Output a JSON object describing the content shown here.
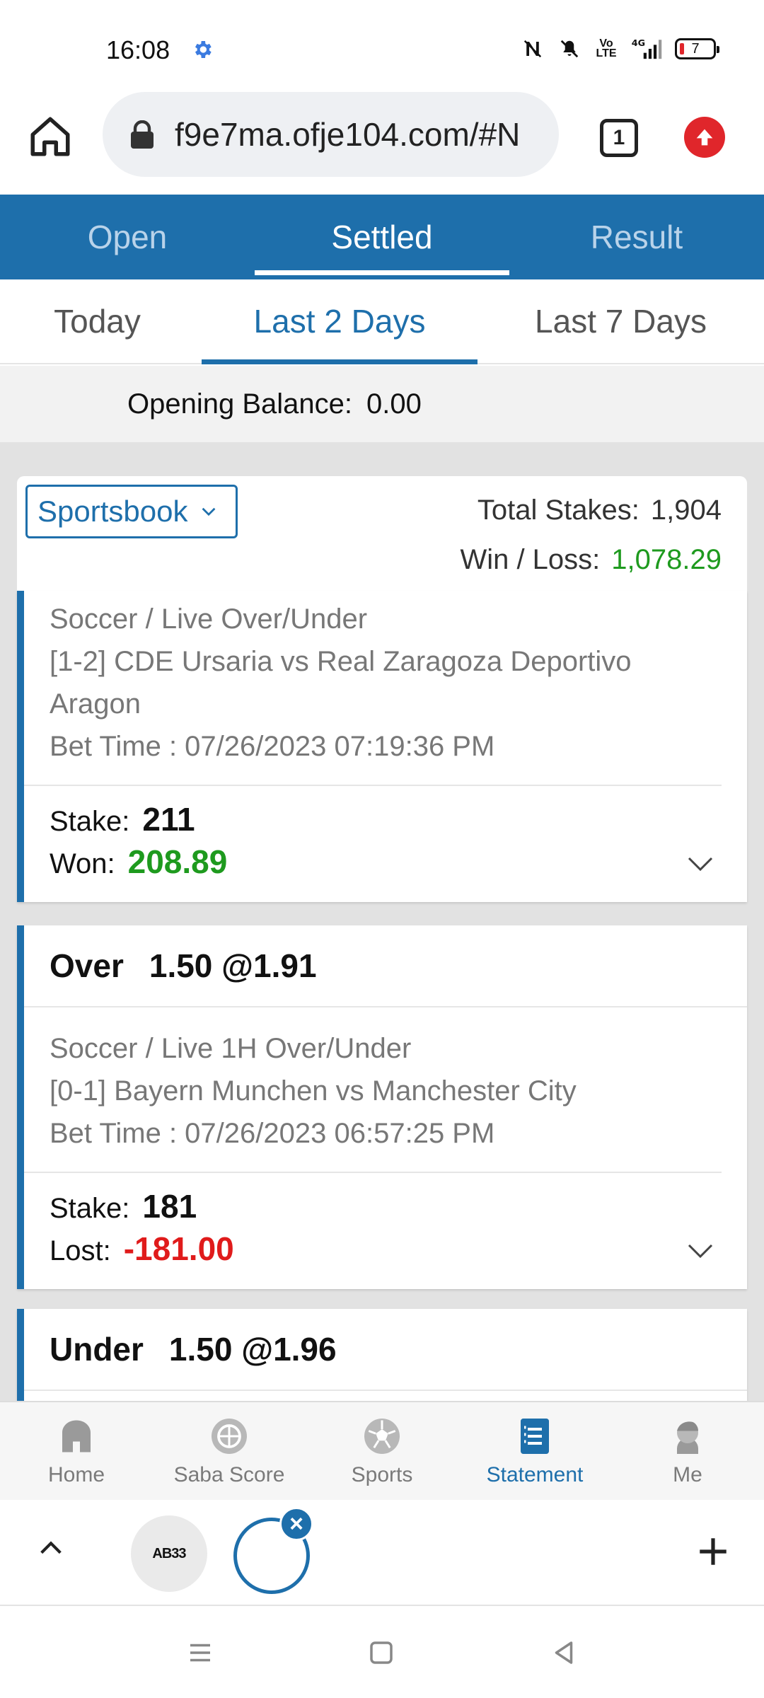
{
  "status_bar": {
    "time": "16:08",
    "network": "4G",
    "volte": "Vo LTE",
    "battery": "7"
  },
  "browser": {
    "url": "f9e7ma.ofje104.com/#N",
    "tab_count": "1"
  },
  "top_tabs": [
    {
      "label": "Open",
      "active": false
    },
    {
      "label": "Settled",
      "active": true
    },
    {
      "label": "Result",
      "active": false
    }
  ],
  "sub_tabs": [
    {
      "label": "Today",
      "active": false
    },
    {
      "label": "Last 2 Days",
      "active": true
    },
    {
      "label": "Last 7 Days",
      "active": false
    }
  ],
  "opening_balance": {
    "label": "Opening Balance:",
    "value": "0.00"
  },
  "summary": {
    "product": "Sportsbook",
    "total_stakes_label": "Total Stakes:",
    "total_stakes": "1,904",
    "win_loss_label": "Win / Loss:",
    "win_loss": "1,078.29"
  },
  "bets": [
    {
      "selection": "",
      "line": "",
      "market": "Soccer / Live Over/Under",
      "match": "[1-2] CDE Ursaria vs Real Zaragoza Deportivo Aragon",
      "bet_time": "Bet Time : 07/26/2023 07:19:36 PM",
      "stake_label": "Stake:",
      "stake": "211",
      "result_label": "Won:",
      "result": "208.89"
    },
    {
      "selection": "Over",
      "line": "1.50 @1.91",
      "market": "Soccer / Live 1H Over/Under",
      "match": "[0-1] Bayern Munchen vs Manchester City",
      "bet_time": "Bet Time : 07/26/2023 06:57:25 PM",
      "stake_label": "Stake:",
      "stake": "181",
      "result_label": "Lost:",
      "result": "-181.00"
    },
    {
      "selection": "Under",
      "line": "1.50 @1.96"
    }
  ],
  "bottom_nav": [
    {
      "label": "Home",
      "icon": "home-icon",
      "active": false
    },
    {
      "label": "Saba Score",
      "icon": "saba-score-icon",
      "active": false
    },
    {
      "label": "Sports",
      "icon": "soccer-ball-icon",
      "active": false
    },
    {
      "label": "Statement",
      "icon": "statement-icon",
      "active": true
    },
    {
      "label": "Me",
      "icon": "user-avatar-icon",
      "active": false
    }
  ],
  "browser_bottom": {
    "site_label": "AB33"
  },
  "colors": {
    "primary": "#1e6fab",
    "won": "#1e9a1e",
    "lost": "#e01b1b"
  }
}
